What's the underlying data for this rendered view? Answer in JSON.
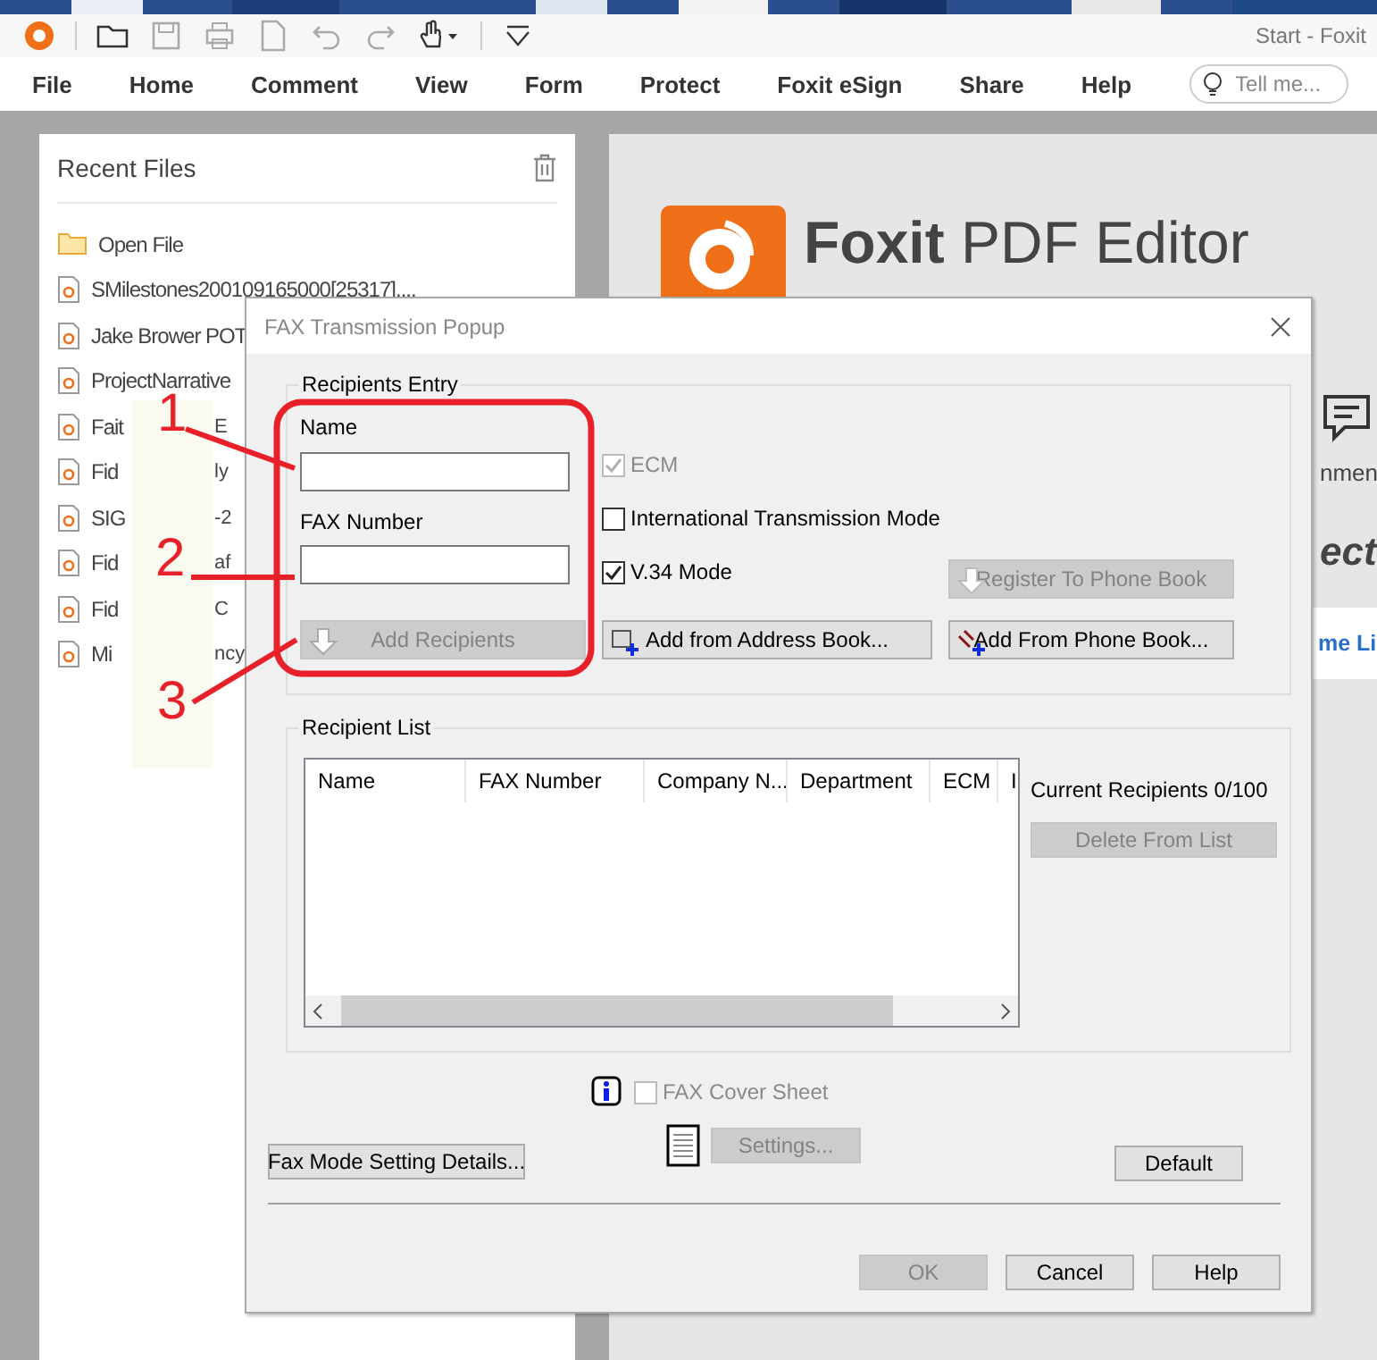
{
  "title_bar": {
    "title": "Start - Foxit"
  },
  "menu": [
    "File",
    "Home",
    "Comment",
    "View",
    "Form",
    "Protect",
    "Foxit eSign",
    "Share",
    "Help"
  ],
  "tell_me": {
    "placeholder": "Tell me..."
  },
  "recent_files": {
    "title": "Recent Files",
    "open_file": "Open File",
    "files": [
      {
        "name": "SMilestones200109165000[25317]...."
      },
      {
        "name": "Jake Brower POT"
      },
      {
        "name": "ProjectNarrative"
      },
      {
        "name": "Fait",
        "tail": "E"
      },
      {
        "name": "Fid",
        "tail": "ly"
      },
      {
        "name": "SIG",
        "tail": "-2"
      },
      {
        "name": "Fid",
        "tail": "af"
      },
      {
        "name": "Fid",
        "tail": "C"
      },
      {
        "name": "Mi",
        "tail": "ncy"
      }
    ]
  },
  "start_page": {
    "brand": "Foxit",
    "product": "PDF Editor",
    "comment_fragment": "nmen",
    "heading_fragment": "ect",
    "link_fragment": "me Li"
  },
  "dialog": {
    "title": "FAX Transmission Popup",
    "recipients_entry": {
      "legend": "Recipients Entry",
      "name_label": "Name",
      "fax_label": "FAX Number",
      "add_recipients": {
        "label": "Add Recipients",
        "disabled": true
      },
      "options": [
        {
          "label": "ECM",
          "checked": true,
          "disabled": true
        },
        {
          "label": "International Transmission Mode",
          "checked": false,
          "disabled": false
        },
        {
          "label": "V.34 Mode",
          "checked": true,
          "disabled": false
        }
      ],
      "register": {
        "label": "Register To Phone Book",
        "disabled": true
      },
      "address_book": {
        "label": "Add from Address Book...",
        "disabled": false
      },
      "phone_book": {
        "label": "Add From Phone Book...",
        "disabled": false
      }
    },
    "recipient_list": {
      "legend": "Recipient List",
      "columns": [
        "Name",
        "FAX Number",
        "Company N...",
        "Department",
        "ECM",
        "I"
      ],
      "count": "Current Recipients 0/100",
      "delete": {
        "label": "Delete From List",
        "disabled": true
      }
    },
    "cover_sheet": {
      "label": "FAX Cover Sheet",
      "checked": false,
      "disabled": true
    },
    "settings": {
      "label": "Settings...",
      "disabled": true
    },
    "fax_mode": {
      "label": "Fax Mode Setting Details...",
      "disabled": false
    },
    "default": {
      "label": "Default",
      "disabled": false
    },
    "footer": [
      {
        "label": "OK",
        "disabled": true
      },
      {
        "label": "Cancel",
        "disabled": false
      },
      {
        "label": "Help",
        "disabled": false
      }
    ]
  },
  "annotations": [
    "1",
    "2",
    "3"
  ]
}
